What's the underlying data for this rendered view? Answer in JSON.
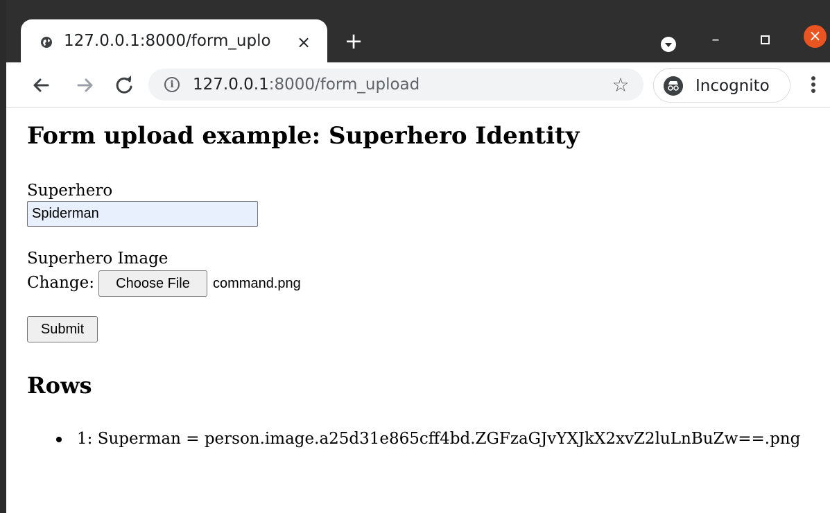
{
  "tab": {
    "title": "127.0.0.1:8000/form_uplo",
    "close_glyph": "×",
    "icon": "globe-icon"
  },
  "window_controls": {
    "new_tab_glyph": "+",
    "minimize_glyph": "–",
    "close_glyph": "×"
  },
  "toolbar": {
    "url_host": "127.0.0.1",
    "url_rest": ":8000/form_upload",
    "info_glyph": "i",
    "star_glyph": "☆",
    "incognito_label": "Incognito"
  },
  "page": {
    "title": "Form upload example: Superhero Identity",
    "superhero_label": "Superhero",
    "superhero_value": "Spiderman",
    "image_label": "Superhero Image",
    "change_label": "Change:",
    "choose_file_label": "Choose File",
    "file_name": "command.png",
    "submit_label": "Submit",
    "rows_title": "Rows",
    "rows": [
      "1: Superman = person.image.a25d31e865cff4bd.ZGFzaGJvYXJkX2xvZ2luLnBuZw==.png"
    ]
  },
  "colors": {
    "tabstrip": "#2f2f2f",
    "close_button": "#e95420",
    "autofill_input": "#e8f0fe"
  }
}
